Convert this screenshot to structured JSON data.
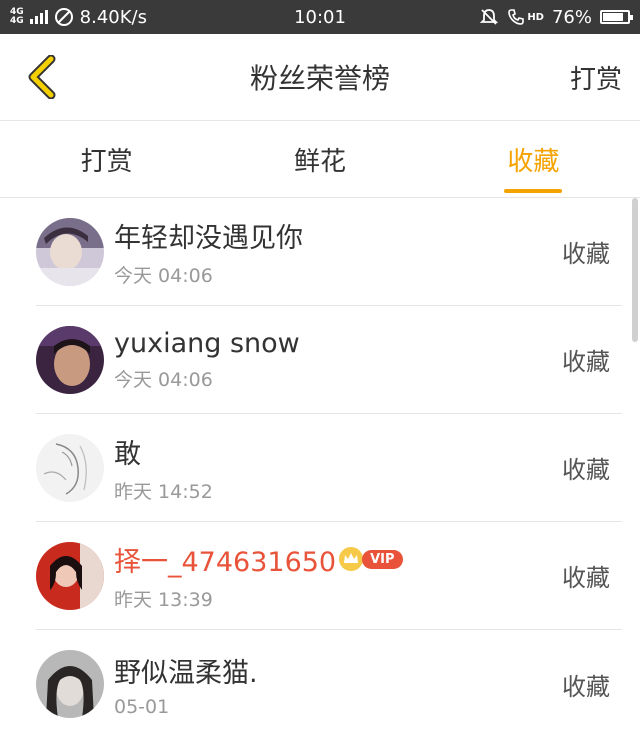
{
  "status_bar": {
    "network_top": "4G",
    "network_bottom": "4G",
    "speed": "8.40K/s",
    "time": "10:01",
    "hd": "HD",
    "battery": "76%"
  },
  "nav": {
    "title": "粉丝荣誉榜",
    "action": "打赏"
  },
  "tabs": [
    {
      "label": "打赏",
      "active": false
    },
    {
      "label": "鲜花",
      "active": false
    },
    {
      "label": "收藏",
      "active": true
    }
  ],
  "rows": [
    {
      "name": "年轻却没遇见你",
      "time": "今天 04:06",
      "action": "收藏",
      "vip": false
    },
    {
      "name": "yuxiang snow",
      "time": "今天 04:06",
      "action": "收藏",
      "vip": false
    },
    {
      "name": "敢",
      "time": "昨天 14:52",
      "action": "收藏",
      "vip": false
    },
    {
      "name": "择一_474631650",
      "time": "昨天 13:39",
      "action": "收藏",
      "vip": true,
      "vip_label": "VIP"
    },
    {
      "name": "野似温柔猫.",
      "time": "05-01",
      "action": "收藏",
      "vip": false
    }
  ],
  "colors": {
    "accent": "#f5a300",
    "vip": "#e8533a",
    "status_bar": "#3a3a3a"
  }
}
